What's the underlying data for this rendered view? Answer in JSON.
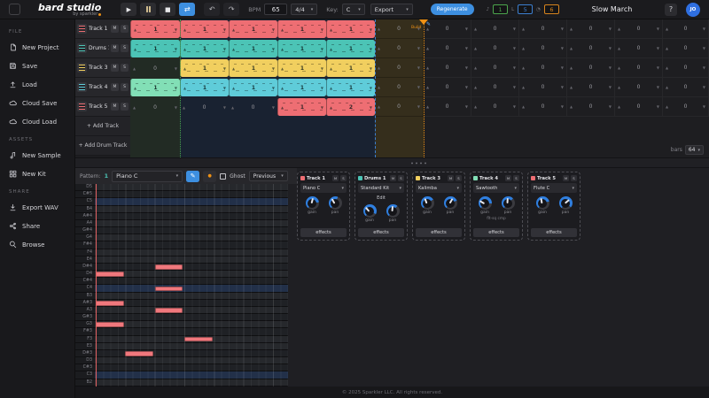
{
  "colors": {
    "red": "#ee6e73",
    "teal": "#4cc4b6",
    "yellow": "#f1cf5f",
    "cyan": "#5fccd9",
    "mint": "#82dfb6",
    "accent": "#3d8fe0",
    "orange": "#ef9114"
  },
  "icons": {
    "chevron_down": "▾",
    "pen": "✎",
    "dot": "●",
    "play": "▶",
    "stop": "■",
    "loop": "⇄",
    "undo": "↶",
    "redo": "↷",
    "cell_up": "▲",
    "cell_down": "▼"
  },
  "topbar": {
    "logo_title": "bard studio",
    "logo_subtitle": "by sparkler",
    "bpm_label": "BPM",
    "bpm_value": "65",
    "time_signature": "4/4",
    "key_label": "Key:",
    "key_value": "C",
    "export_value": "Export",
    "regenerate_label": "Regenerate",
    "counters": [
      {
        "icon": "♪",
        "value": "1",
        "color": "#4ca64c"
      },
      {
        "icon": "L",
        "value": "5",
        "color": "#3c7fd0"
      },
      {
        "icon": "◔",
        "value": "6",
        "color": "#d7841e"
      }
    ],
    "song_title": "Slow March",
    "help_label": "?",
    "avatar_initials": "JO"
  },
  "sidebar": {
    "sections": [
      {
        "title": "FILE",
        "items": [
          {
            "icon": "file",
            "label": "New Project"
          },
          {
            "icon": "save",
            "label": "Save"
          },
          {
            "icon": "load",
            "label": "Load"
          },
          {
            "icon": "cloud",
            "label": "Cloud Save"
          },
          {
            "icon": "cloud",
            "label": "Cloud Load"
          }
        ]
      },
      {
        "title": "ASSETS",
        "items": [
          {
            "icon": "note",
            "label": "New Sample"
          },
          {
            "icon": "kit",
            "label": "New Kit"
          }
        ]
      },
      {
        "title": "SHARE",
        "items": [
          {
            "icon": "download",
            "label": "Export WAV"
          },
          {
            "icon": "share",
            "label": "Share"
          },
          {
            "icon": "search",
            "label": "Browse"
          }
        ]
      }
    ]
  },
  "tracks": {
    "mute_label": "M",
    "solo_label": "S",
    "add_track_label": "+ Add Track",
    "add_drum_label": "+ Add Drum Track",
    "rows": [
      {
        "name": "Track 1",
        "color": "red",
        "cells": [
          "r1",
          "r1",
          "r1",
          "r1",
          "r1",
          "0",
          "0",
          "0",
          "0",
          "0",
          "0",
          "0"
        ]
      },
      {
        "name": "Drums 1",
        "color": "teal",
        "cells": [
          "t1",
          "t1",
          "t1",
          "t1",
          "t1",
          "0",
          "0",
          "0",
          "0",
          "0",
          "0",
          "0"
        ]
      },
      {
        "name": "Track 3",
        "color": "yellow",
        "cells": [
          "0",
          "y1",
          "y1",
          "y1",
          "y1",
          "0",
          "0",
          "0",
          "0",
          "0",
          "0",
          "0"
        ]
      },
      {
        "name": "Track 4",
        "color": "cyan",
        "cells": [
          "m1",
          "c1",
          "c1",
          "c1",
          "c1",
          "0",
          "0",
          "0",
          "0",
          "0",
          "0",
          "0"
        ]
      },
      {
        "name": "Track 5",
        "color": "red",
        "cells": [
          "0",
          "0",
          "0",
          "r1",
          "r2",
          "0",
          "0",
          "0",
          "0",
          "0",
          "0",
          "0"
        ]
      }
    ]
  },
  "timeline": {
    "marker_label": "Build",
    "bars_label": "bars",
    "bars_value": "64"
  },
  "pianoroll": {
    "pattern_label": "Pattern:",
    "pattern_value": "1",
    "instrument_value": "Piano C",
    "ghost_label": "Ghost",
    "previous_value": "Previous",
    "row_labels": [
      "D5",
      "C#5",
      "C5",
      "B4",
      "A#4",
      "A4",
      "G#4",
      "G4",
      "F#4",
      "F4",
      "E4",
      "D#4",
      "D4",
      "C#4",
      "C4",
      "B3",
      "A#3",
      "A3",
      "G#3",
      "G3",
      "F#3",
      "F3",
      "E3",
      "D#3",
      "D3",
      "C#3",
      "C3",
      "B2"
    ],
    "highlighted_rows": [
      "C5",
      "C4",
      "C3"
    ],
    "notes": [
      {
        "note": "D#4",
        "start": 8,
        "length": 4
      },
      {
        "note": "D4",
        "start": 0,
        "length": 4
      },
      {
        "note": "C4",
        "start": 8,
        "length": 4
      },
      {
        "note": "A#3",
        "start": 0,
        "length": 4
      },
      {
        "note": "A3",
        "start": 8,
        "length": 4
      },
      {
        "note": "G3",
        "start": 0,
        "length": 4
      },
      {
        "note": "F3",
        "start": 12,
        "length": 4
      },
      {
        "note": "D#3",
        "start": 4,
        "length": 4
      }
    ]
  },
  "mixer": {
    "gain_label": "gain",
    "pan_label": "pan",
    "effects_label": "effects",
    "cards": [
      {
        "name": "Track 1",
        "color": "red",
        "instrument": "Piano C"
      },
      {
        "name": "Drums 1",
        "color": "teal",
        "instrument": "Standard Kit",
        "edit_label": "Edit"
      },
      {
        "name": "Track 3",
        "color": "yellow",
        "instrument": "Kalimba"
      },
      {
        "name": "Track 4",
        "color": "mint",
        "instrument": "Sawtooth",
        "chips": "flt-sq cmp"
      },
      {
        "name": "Track 5",
        "color": "red",
        "instrument": "Flute C"
      }
    ]
  },
  "footer_text": "© 2025 Sparkler LLC. All rights reserved."
}
